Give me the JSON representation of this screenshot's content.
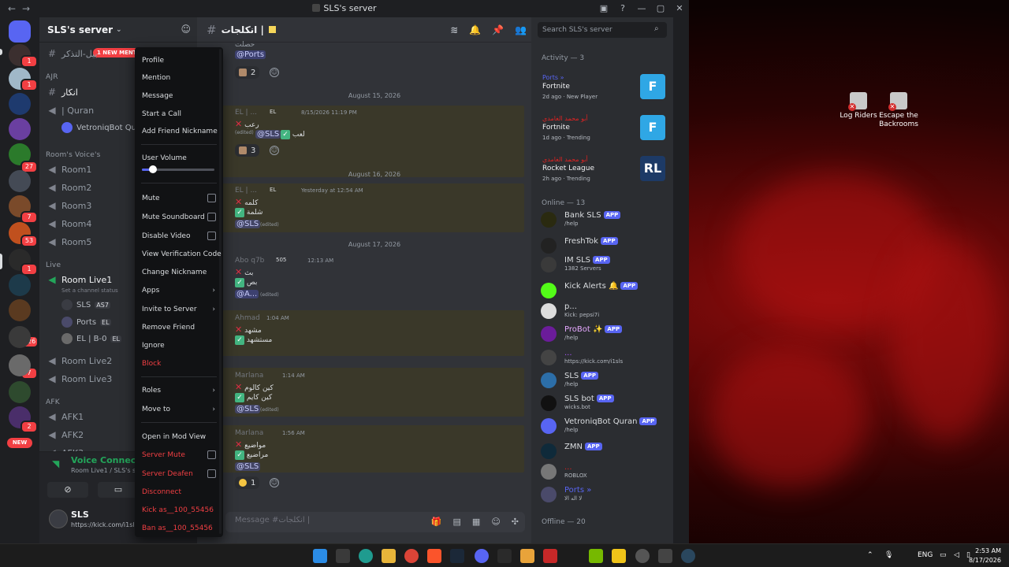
{
  "window": {
    "title": "SLS's server",
    "nav": [
      "←",
      "→"
    ],
    "controls": [
      "▣",
      "?",
      "—",
      "▢",
      "✕"
    ]
  },
  "rail": {
    "new_badge": "NEW",
    "badges": [
      "1",
      "1",
      "27",
      "7",
      "53",
      "1",
      "626",
      "7",
      "1",
      "2"
    ]
  },
  "server": {
    "name": "SLS's server",
    "new_mention": "1 NEW MENTI",
    "channels": {
      "top_channel": "بيل-التذكر",
      "ajr_category": "AJR",
      "ajr_text": "انكار",
      "quran_voice": "| Quran",
      "quran_bot": "VetroniqBot Qura",
      "rooms_category": "Room's Voice's",
      "rooms": [
        "Room1",
        "Room2",
        "Room3",
        "Room4",
        "Room5"
      ],
      "live_category": "Live",
      "live_room": "Room Live1",
      "channel_status": "Set a channel status",
      "live_members": [
        {
          "name": "SLS",
          "tag": "AS7"
        },
        {
          "name": "Ports",
          "tag": "EL"
        },
        {
          "name": "EL | B-0",
          "tag": "EL"
        }
      ],
      "live_rooms_more": [
        "Room Live2",
        "Room Live3"
      ],
      "afk_category": "AFK",
      "afk_rooms": [
        "AFK1",
        "AFK2",
        "AFK3"
      ]
    },
    "voice": {
      "status": "Voice Connected",
      "where": "Room Live1 / SLS's server"
    },
    "user": {
      "name": "SLS",
      "status": "https://kick.com/i1sls"
    }
  },
  "chat": {
    "channel_name": "انكلجات |",
    "composer_placeholder": "Message #انكلجات |",
    "dates": [
      "August 15, 2026",
      "August 16, 2026",
      "August 17, 2026"
    ],
    "messages": [
      {
        "top_text": "حصلت",
        "mention": "@Ports",
        "reaction_count": "2"
      },
      {
        "author": "EL | ...",
        "tag": "EL",
        "time": "8/15/2026 11:19 PM",
        "line1": "رعب",
        "line2": "لعب",
        "edited": "(edited)",
        "mention": "@SLS",
        "reaction_count": "3"
      },
      {
        "author": "EL | ...",
        "tag": "EL",
        "time": "Yesterday at 12:54 AM",
        "line1": "كلمه",
        "line2": "شلمة",
        "mention": "@SLS",
        "edited": "(edited)"
      },
      {
        "author": "Abo q7b",
        "tag": "505",
        "time": "12:13 AM",
        "line1": "بث",
        "line2": "بص",
        "mention": "@A...",
        "edited": "(edited)"
      },
      {
        "author": "Ahmad",
        "time": "1:04 AM",
        "line1": "مشهد",
        "line2": "مستشهد"
      },
      {
        "author": "Marlana",
        "time": "1:14 AM",
        "line1": "كين كالوم",
        "line2": "كين كايم",
        "mention": "@SLS",
        "edited": "(edited)"
      },
      {
        "author": "Marlana",
        "time": "1:56 AM",
        "line1": "مواضيع",
        "line2": "مراضيع",
        "mention": "@SLS",
        "reaction_count": "1"
      }
    ]
  },
  "members": {
    "search_placeholder": "Search SLS's server",
    "activity_title": "Activity — 3",
    "activities": [
      {
        "user": "Ports »",
        "game": "Fortnite",
        "meta": "2d ago  ·  New Player",
        "art": "F"
      },
      {
        "user": "أبو محمد الغامدي",
        "game": "Fortnite",
        "meta": "1d ago  ·  Trending",
        "art": "F"
      },
      {
        "user": "أبو محمد الغامدي",
        "game": "Rocket League",
        "meta": "2h ago  ·  Trending",
        "art": "RL"
      }
    ],
    "online_title": "Online — 13",
    "online": [
      {
        "name": "Bank SLS",
        "app": "APP",
        "sub": "/help"
      },
      {
        "name": "FreshTok",
        "app": "APP",
        "sub": ""
      },
      {
        "name": "IM SLS",
        "app": "APP",
        "sub": "1382 Servers"
      },
      {
        "name": "Kick Alerts 🔔",
        "app": "APP",
        "sub": ""
      },
      {
        "name": "p...",
        "app": "",
        "sub": "Kick: pepsi7i"
      },
      {
        "name": "ProBot ✨",
        "app": "APP",
        "sub": "/help"
      },
      {
        "name": "...",
        "app": "",
        "sub": "https://kick.com/i1sls"
      },
      {
        "name": "SLS",
        "app": "APP",
        "sub": "/help"
      },
      {
        "name": "SLS bot",
        "app": "APP",
        "sub": "wicks.bot"
      },
      {
        "name": "VetroniqBot Quran",
        "app": "APP",
        "sub": "/help"
      },
      {
        "name": "ZMN",
        "app": "APP",
        "sub": ""
      },
      {
        "name": "...",
        "app": "",
        "sub": "ROBLOX"
      },
      {
        "name": "Ports »",
        "app": "",
        "sub": "لا اله الا"
      }
    ],
    "offline_title": "Offline — 20"
  },
  "context_menu": {
    "items_top": [
      "Profile",
      "Mention",
      "Message",
      "Start a Call",
      "Add Friend Nickname"
    ],
    "user_volume": "User Volume",
    "volume_level": 0.15,
    "toggles": [
      "Mute",
      "Mute Soundboard",
      "Disable Video"
    ],
    "items_mid": [
      "View Verification Code",
      "Change Nickname"
    ],
    "submenus": [
      "Apps",
      "Invite to Server"
    ],
    "items_more": [
      "Remove Friend",
      "Ignore"
    ],
    "block": "Block",
    "roles": "Roles",
    "move_to": "Move to",
    "mod_view": "Open in Mod View",
    "server_mute": "Server Mute",
    "server_deafen": "Server Deafen",
    "disconnect": "Disconnect",
    "kick": "Kick as__100_55456",
    "ban": "Ban as__100_55456"
  },
  "desktop": {
    "icons": [
      "Log Riders",
      "Escape the Backrooms"
    ]
  },
  "taskbar": {
    "lang": "ENG",
    "time": "2:53 AM",
    "date": "8/17/2026"
  }
}
